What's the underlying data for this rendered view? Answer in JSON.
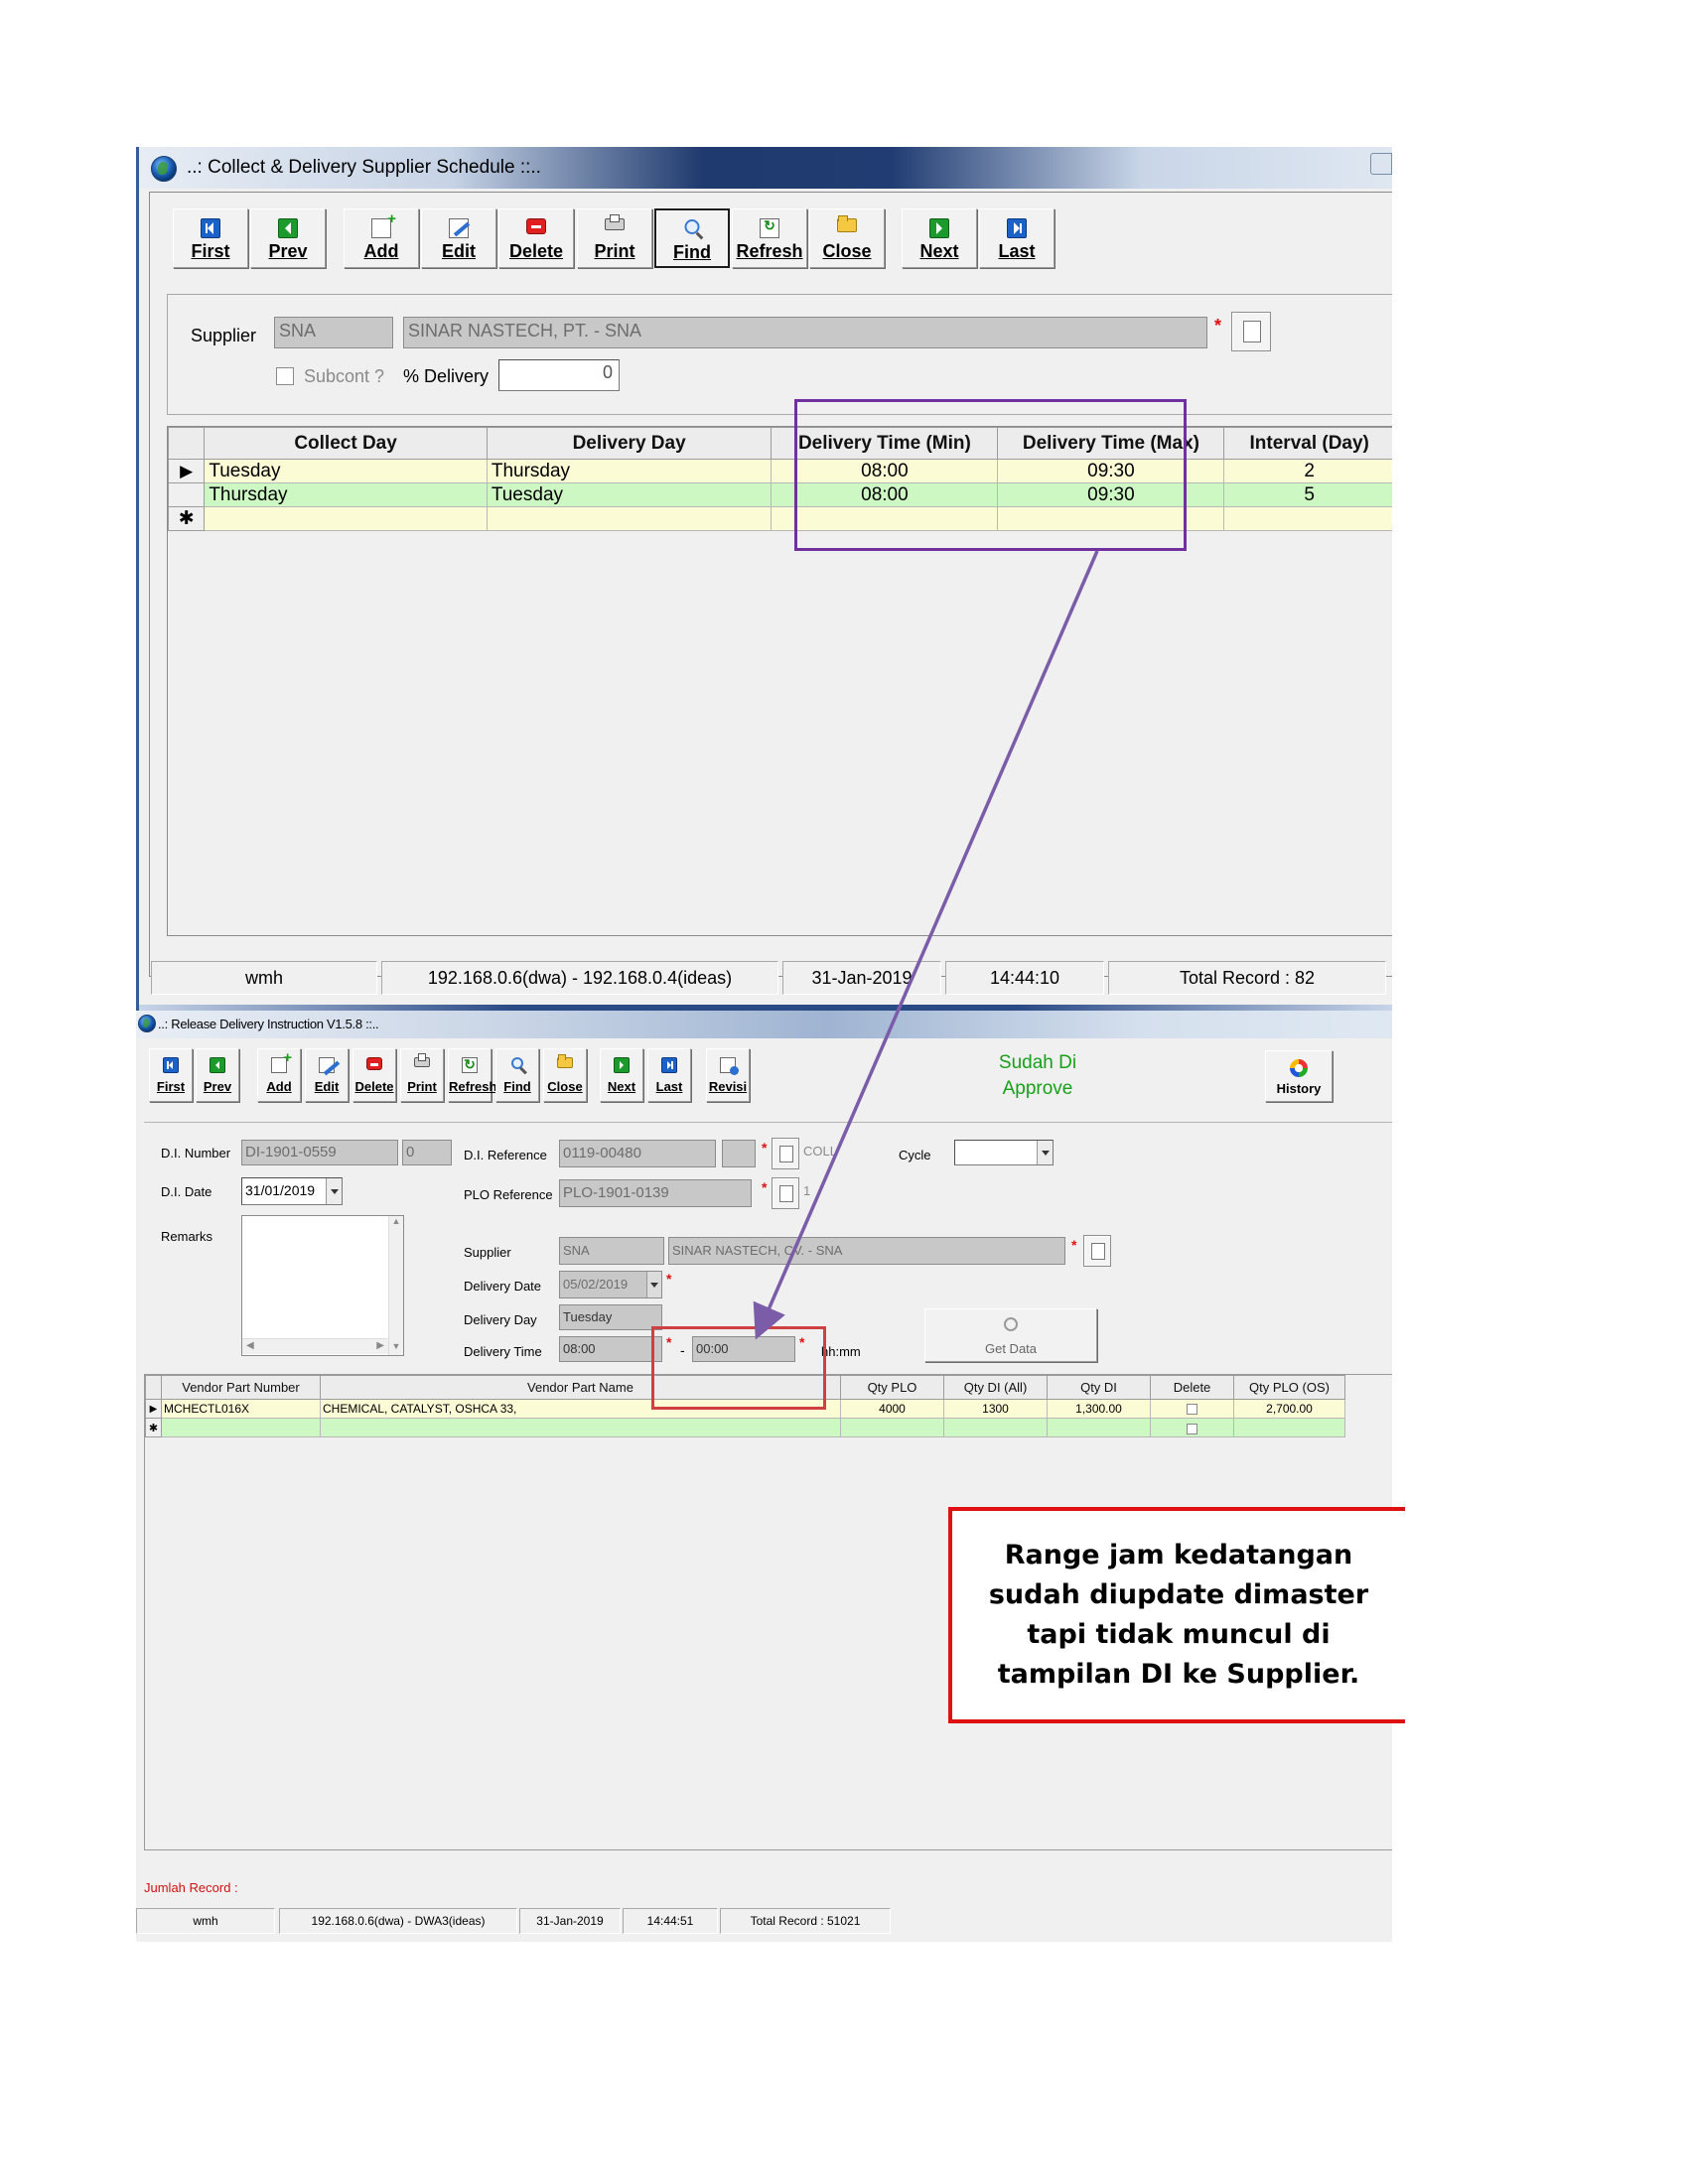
{
  "schedule_window": {
    "title": "..: Collect & Delivery Supplier Schedule ::..",
    "toolbar": [
      {
        "key": "first",
        "label": "First",
        "icon": "nav-first-icon"
      },
      {
        "key": "prev",
        "label": "Prev",
        "icon": "nav-prev-icon"
      },
      {
        "key": "add",
        "label": "Add",
        "icon": "add-icon"
      },
      {
        "key": "edit",
        "label": "Edit",
        "icon": "edit-icon"
      },
      {
        "key": "delete",
        "label": "Delete",
        "icon": "delete-icon"
      },
      {
        "key": "print",
        "label": "Print",
        "icon": "print-icon"
      },
      {
        "key": "find",
        "label": "Find",
        "icon": "find-icon"
      },
      {
        "key": "refresh",
        "label": "Refresh",
        "icon": "refresh-icon"
      },
      {
        "key": "close",
        "label": "Close",
        "icon": "close-folder-icon"
      },
      {
        "key": "next",
        "label": "Next",
        "icon": "nav-next-icon"
      },
      {
        "key": "last",
        "label": "Last",
        "icon": "nav-last-icon"
      }
    ],
    "form": {
      "supplier_label": "Supplier",
      "supplier_code": "SNA",
      "supplier_name": "SINAR NASTECH, PT. - SNA",
      "required_mark": "*",
      "subcont_label": "Subcont ?",
      "delivery_pct_label": "% Delivery",
      "delivery_pct_value": "0"
    },
    "grid": {
      "headers": [
        "Collect Day",
        "Delivery Day",
        "Delivery Time (Min)",
        "Delivery Time (Max)",
        "Interval (Day)"
      ],
      "rows": [
        {
          "indicator": "▶",
          "collect": "Tuesday",
          "delivery": "Thursday",
          "min": "08:00",
          "max": "09:30",
          "interval": "2"
        },
        {
          "indicator": "",
          "collect": "Thursday",
          "delivery": "Tuesday",
          "min": "08:00",
          "max": "09:30",
          "interval": "5"
        }
      ],
      "new_row_marker": "✱"
    },
    "status": {
      "user": "wmh",
      "server": "192.168.0.6(dwa) - 192.168.0.4(ideas)",
      "date": "31-Jan-2019",
      "time": "14:44:10",
      "total_label": "Total Record  :  82"
    }
  },
  "di_window": {
    "title": "..: Release Delivery Instruction V1.5.8 ::..",
    "toolbar": [
      {
        "key": "first",
        "label": "First",
        "icon": "nav-first-icon"
      },
      {
        "key": "prev",
        "label": "Prev",
        "icon": "nav-prev-icon"
      },
      {
        "key": "add",
        "label": "Add",
        "icon": "add-icon"
      },
      {
        "key": "edit",
        "label": "Edit",
        "icon": "edit-icon"
      },
      {
        "key": "delete",
        "label": "Delete",
        "icon": "delete-icon"
      },
      {
        "key": "print",
        "label": "Print",
        "icon": "print-icon"
      },
      {
        "key": "refresh",
        "label": "Refresh",
        "icon": "refresh-icon"
      },
      {
        "key": "find",
        "label": "Find",
        "icon": "find-icon"
      },
      {
        "key": "close",
        "label": "Close",
        "icon": "close-folder-icon"
      },
      {
        "key": "next",
        "label": "Next",
        "icon": "nav-next-icon"
      },
      {
        "key": "last",
        "label": "Last",
        "icon": "nav-last-icon"
      },
      {
        "key": "revisi",
        "label": "Revisi",
        "icon": "revisi-icon"
      }
    ],
    "approval_status": [
      "Sudah Di",
      "Approve"
    ],
    "history_label": "History",
    "form": {
      "di_number_label": "D.I. Number",
      "di_number": "DI-1901-0559",
      "di_number_suffix": "0",
      "di_date_label": "D.I. Date",
      "di_date": "31/01/2019",
      "remarks_label": "Remarks",
      "remarks": "",
      "di_reference_label": "D.I. Reference",
      "di_reference": "0119-00480",
      "di_reference_extra": "COLL",
      "plo_reference_label": "PLO Reference",
      "plo_reference": "PLO-1901-0139",
      "plo_reference_extra": "1",
      "cycle_label": "Cycle",
      "cycle_value": "",
      "supplier_label": "Supplier",
      "supplier_code": "SNA",
      "supplier_name": "SINAR NASTECH, CV. - SNA",
      "delivery_date_label": "Delivery Date",
      "delivery_date": "05/02/2019",
      "delivery_day_label": "Delivery Day",
      "delivery_day": "Tuesday",
      "delivery_time_label": "Delivery Time",
      "delivery_time_from": "08:00",
      "delivery_time_to": "00:00",
      "time_separator": "-",
      "time_format_hint": "hh:mm",
      "required_mark": "*",
      "get_data_label": "Get Data"
    },
    "grid": {
      "headers": [
        "Vendor Part Number",
        "Vendor Part Name",
        "Qty PLO",
        "Qty DI (All)",
        "Qty DI",
        "Delete",
        "Qty PLO (OS)"
      ],
      "rows": [
        {
          "indicator": "▶",
          "part_number": "MCHECTL016X",
          "part_name": "CHEMICAL, CATALYST,  OSHCA 33,",
          "qty_plo": "4000",
          "qty_di_all": "1300",
          "qty_di": "1,300.00",
          "delete": false,
          "qty_plo_os": "2,700.00"
        }
      ],
      "new_row_marker": "✱"
    },
    "jumlah_record_label": "Jumlah Record :",
    "status": {
      "user": "wmh",
      "server": "192.168.0.6(dwa) - DWA3(ideas)",
      "date": "31-Jan-2019",
      "time": "14:44:51",
      "total_label": "Total Record  :  51021"
    }
  },
  "annotation": {
    "note": "Range jam kedatangan sudah diupdate dimaster tapi tidak muncul di tampilan DI ke Supplier.",
    "colors": {
      "highlight_box": "#7030a0",
      "arrow": "#7b5ca8",
      "time_box": "#d04040",
      "note_border": "#e01010"
    }
  }
}
